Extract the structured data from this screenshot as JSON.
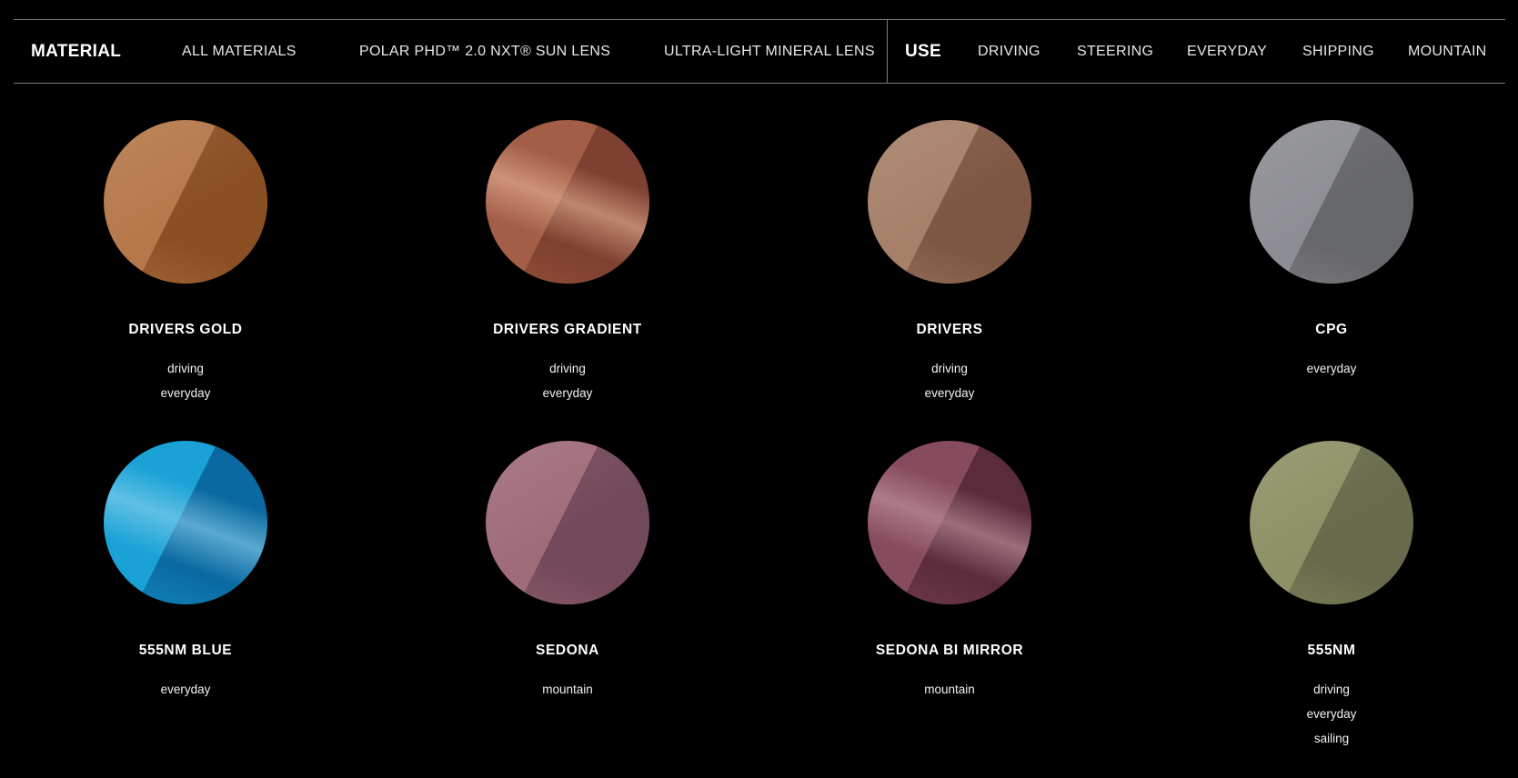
{
  "filters": {
    "material_heading": "MATERIAL",
    "material_options": [
      "ALL MATERIALS",
      "POLAR PHD™ 2.0 NXT® SUN LENS",
      "ULTRA-LIGHT MINERAL LENS"
    ],
    "use_heading": "USE",
    "use_options": [
      "DRIVING",
      "STEERING",
      "EVERYDAY",
      "SHIPPING",
      "MOUNTAIN"
    ]
  },
  "lenses": [
    {
      "name": "DRIVERS GOLD",
      "tags": [
        "driving",
        "everyday"
      ],
      "color_light": "#b5784a",
      "color_dark": "#8a4f23",
      "shine": false
    },
    {
      "name": "DRIVERS GRADIENT",
      "tags": [
        "driving",
        "everyday"
      ],
      "color_light": "#a35e47",
      "color_dark": "#7e4030",
      "shine": true,
      "shine_color": "#e9b49a"
    },
    {
      "name": "DRIVERS",
      "tags": [
        "driving",
        "everyday"
      ],
      "color_light": "#a68069",
      "color_dark": "#7d5743",
      "shine": false
    },
    {
      "name": "CPG",
      "tags": [
        "everyday"
      ],
      "color_light": "#8d8e93",
      "color_dark": "#66676b",
      "shine": false
    },
    {
      "name": "555NM BLUE",
      "tags": [
        "everyday"
      ],
      "color_light": "#1aa2d6",
      "color_dark": "#0a69a1",
      "shine": true,
      "shine_color": "#8fd4ee"
    },
    {
      "name": "SEDONA",
      "tags": [
        "mountain"
      ],
      "color_light": "#a06b79",
      "color_dark": "#72495a",
      "shine": false
    },
    {
      "name": "SEDONA BI MIRROR",
      "tags": [
        "mountain"
      ],
      "color_light": "#864b5c",
      "color_dark": "#5a2b3b",
      "shine": true,
      "shine_color": "#c89aa5"
    },
    {
      "name": "555NM",
      "tags": [
        "driving",
        "everyday",
        "sailing"
      ],
      "color_light": "#8e9166",
      "color_dark": "#686a4b",
      "shine": false
    }
  ]
}
